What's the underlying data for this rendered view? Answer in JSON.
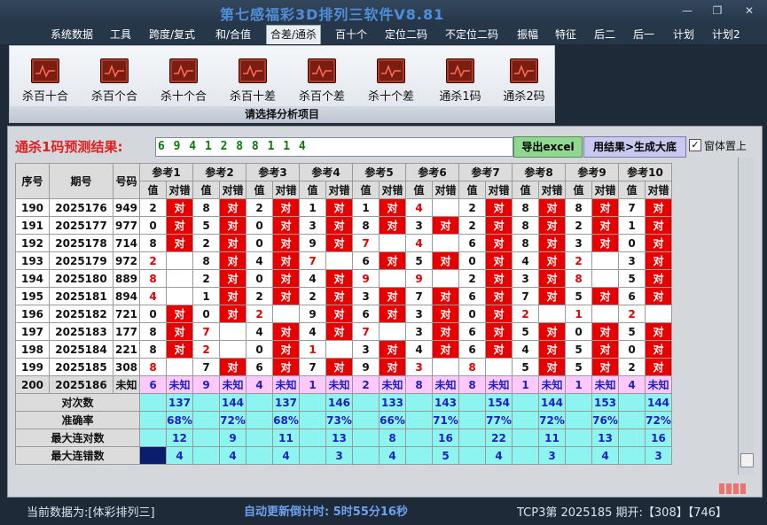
{
  "app": {
    "title": "第七感福彩3D排列三软件V8.81"
  },
  "window_buttons": {
    "min": "—",
    "max": "❐",
    "close": "✕"
  },
  "menu": {
    "items": [
      "系统数据",
      "工具",
      "跨度/复式",
      "和/合值",
      "合差/通杀",
      "百十个",
      "定位二码",
      "不定位二码",
      "振幅",
      "特征",
      "后二",
      "后一",
      "计划",
      "计划2"
    ],
    "active_index": 4
  },
  "ribbon": {
    "buttons": [
      "杀百十合",
      "杀百个合",
      "杀十个合",
      "杀百十差",
      "杀百个差",
      "杀十个差",
      "通杀1码",
      "通杀2码"
    ],
    "footer": "请选择分析项目"
  },
  "prediction": {
    "label": "通杀1码预测结果:",
    "value": "6 9 4 1 2 8 8 1 1 4",
    "export_button": "导出excel",
    "generate_button": "用结果>生成大底",
    "pin_label": "窗体置上",
    "pin_checked": true,
    "pin_mark": "✓"
  },
  "table": {
    "headers": {
      "seq": "序号",
      "period": "期号",
      "number": "号码",
      "value": "值",
      "result": "对错"
    },
    "refs": [
      "参考1",
      "参考2",
      "参考3",
      "参考4",
      "参考5",
      "参考6",
      "参考7",
      "参考8",
      "参考9",
      "参考10"
    ],
    "hit_text": "对",
    "rows": [
      {
        "seq": "190",
        "period": "2025176",
        "num": "949",
        "cells": [
          [
            "2",
            "m"
          ],
          [
            "8",
            "m"
          ],
          [
            "2",
            "m"
          ],
          [
            "1",
            "m"
          ],
          [
            "1",
            "m"
          ],
          [
            "4",
            "h"
          ],
          [
            "2",
            "m"
          ],
          [
            "8",
            "m"
          ],
          [
            "8",
            "m"
          ],
          [
            "7",
            "m"
          ]
        ]
      },
      {
        "seq": "191",
        "period": "2025177",
        "num": "977",
        "cells": [
          [
            "0",
            "m"
          ],
          [
            "5",
            "m"
          ],
          [
            "0",
            "m"
          ],
          [
            "3",
            "m"
          ],
          [
            "8",
            "m"
          ],
          [
            "3",
            "m"
          ],
          [
            "2",
            "m"
          ],
          [
            "8",
            "m"
          ],
          [
            "2",
            "m"
          ],
          [
            "1",
            "m"
          ]
        ]
      },
      {
        "seq": "192",
        "period": "2025178",
        "num": "714",
        "cells": [
          [
            "8",
            "m"
          ],
          [
            "2",
            "m"
          ],
          [
            "0",
            "m"
          ],
          [
            "9",
            "m"
          ],
          [
            "7",
            "h"
          ],
          [
            "4",
            "h"
          ],
          [
            "6",
            "m"
          ],
          [
            "8",
            "m"
          ],
          [
            "3",
            "m"
          ],
          [
            "0",
            "m"
          ]
        ]
      },
      {
        "seq": "193",
        "period": "2025179",
        "num": "972",
        "cells": [
          [
            "2",
            "h"
          ],
          [
            "8",
            "m"
          ],
          [
            "4",
            "m"
          ],
          [
            "7",
            "h"
          ],
          [
            "6",
            "m"
          ],
          [
            "5",
            "m"
          ],
          [
            "0",
            "m"
          ],
          [
            "4",
            "m"
          ],
          [
            "2",
            "h"
          ],
          [
            "3",
            "m"
          ]
        ]
      },
      {
        "seq": "194",
        "period": "2025180",
        "num": "889",
        "cells": [
          [
            "8",
            "h"
          ],
          [
            "2",
            "m"
          ],
          [
            "0",
            "m"
          ],
          [
            "4",
            "m"
          ],
          [
            "9",
            "h"
          ],
          [
            "9",
            "h"
          ],
          [
            "2",
            "m"
          ],
          [
            "3",
            "m"
          ],
          [
            "8",
            "h"
          ],
          [
            "5",
            "m"
          ]
        ]
      },
      {
        "seq": "195",
        "period": "2025181",
        "num": "894",
        "cells": [
          [
            "4",
            "h"
          ],
          [
            "1",
            "m"
          ],
          [
            "2",
            "m"
          ],
          [
            "2",
            "m"
          ],
          [
            "3",
            "m"
          ],
          [
            "7",
            "m"
          ],
          [
            "6",
            "m"
          ],
          [
            "7",
            "m"
          ],
          [
            "5",
            "m"
          ],
          [
            "6",
            "m"
          ]
        ]
      },
      {
        "seq": "196",
        "period": "2025182",
        "num": "721",
        "cells": [
          [
            "0",
            "m"
          ],
          [
            "0",
            "m"
          ],
          [
            "2",
            "h"
          ],
          [
            "9",
            "m"
          ],
          [
            "6",
            "m"
          ],
          [
            "3",
            "m"
          ],
          [
            "0",
            "m"
          ],
          [
            "2",
            "h"
          ],
          [
            "1",
            "h"
          ],
          [
            "2",
            "h"
          ]
        ]
      },
      {
        "seq": "197",
        "period": "2025183",
        "num": "177",
        "cells": [
          [
            "8",
            "m"
          ],
          [
            "7",
            "h"
          ],
          [
            "4",
            "m"
          ],
          [
            "4",
            "m"
          ],
          [
            "7",
            "h"
          ],
          [
            "3",
            "m"
          ],
          [
            "6",
            "m"
          ],
          [
            "5",
            "m"
          ],
          [
            "0",
            "m"
          ],
          [
            "5",
            "m"
          ]
        ]
      },
      {
        "seq": "198",
        "period": "2025184",
        "num": "221",
        "cells": [
          [
            "8",
            "m"
          ],
          [
            "2",
            "h"
          ],
          [
            "0",
            "m"
          ],
          [
            "1",
            "h"
          ],
          [
            "3",
            "m"
          ],
          [
            "4",
            "m"
          ],
          [
            "6",
            "m"
          ],
          [
            "4",
            "m"
          ],
          [
            "5",
            "m"
          ],
          [
            "0",
            "m"
          ]
        ]
      },
      {
        "seq": "199",
        "period": "2025185",
        "num": "308",
        "cells": [
          [
            "8",
            "h"
          ],
          [
            "7",
            "m"
          ],
          [
            "6",
            "m"
          ],
          [
            "7",
            "m"
          ],
          [
            "9",
            "m"
          ],
          [
            "3",
            "h"
          ],
          [
            "8",
            "h"
          ],
          [
            "5",
            "m"
          ],
          [
            "5",
            "m"
          ],
          [
            "2",
            "m"
          ]
        ]
      }
    ],
    "row200": {
      "seq": "200",
      "period": "2025186",
      "num": "未知",
      "values": [
        "6",
        "9",
        "4",
        "1",
        "2",
        "8",
        "8",
        "1",
        "1",
        "4"
      ],
      "unknown": "未知"
    },
    "stats": [
      {
        "label": "对次数",
        "values": [
          "137",
          "144",
          "137",
          "146",
          "133",
          "143",
          "154",
          "144",
          "153",
          "144"
        ]
      },
      {
        "label": "准确率",
        "values": [
          "68%",
          "72%",
          "68%",
          "73%",
          "66%",
          "71%",
          "77%",
          "72%",
          "76%",
          "72%"
        ]
      },
      {
        "label": "最大连对数",
        "values": [
          "12",
          "9",
          "11",
          "13",
          "8",
          "16",
          "22",
          "11",
          "13",
          "16"
        ]
      },
      {
        "label": "最大连错数",
        "values": [
          "4",
          "4",
          "4",
          "3",
          "4",
          "5",
          "4",
          "3",
          "4",
          "3"
        ]
      }
    ]
  },
  "status": {
    "current_data": "当前数据为:[体彩排列三]",
    "countdown": "自动更新倒计时:  5时55分16秒",
    "latest": "TCP3第 2025185 期开:【308】【746】"
  }
}
